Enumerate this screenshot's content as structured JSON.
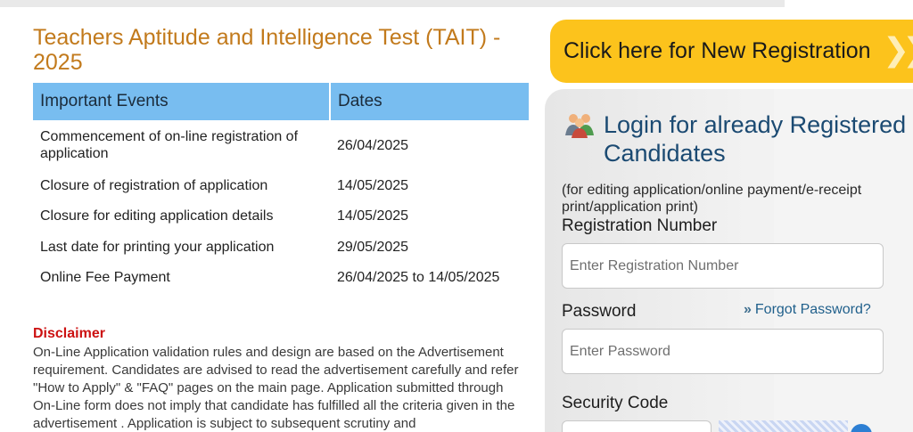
{
  "left": {
    "title": "Teachers Aptitude and Intelligence Test (TAIT) - 2025",
    "table": {
      "headers": [
        "Important Events",
        "Dates"
      ],
      "rows": [
        {
          "event": "Commencement of on-line registration of application",
          "date": "26/04/2025"
        },
        {
          "event": "Closure of registration of application",
          "date": "14/05/2025"
        },
        {
          "event": "Closure for editing application details",
          "date": "14/05/2025"
        },
        {
          "event": "Last date for printing your application",
          "date": "29/05/2025"
        },
        {
          "event": "Online Fee Payment",
          "date": "26/04/2025 to 14/05/2025"
        }
      ]
    },
    "disclaimer": {
      "title": "Disclaimer",
      "text": "On-Line Application validation rules and design are based on the Advertisement requirement. Candidates are advised to read the advertisement carefully and refer \"How to Apply\" & \"FAQ\" pages on the main page. Application submitted through On-Line form does not imply that candidate has fulfilled all the criteria given in the advertisement . Application is subject to subsequent scrutiny and"
    }
  },
  "right": {
    "new_registration_label": "Click here for New Registration",
    "login_title": "Login for already Registered Candidates",
    "login_note": "(for editing application/online payment/e-receipt print/application print)",
    "registration_label": "Registration Number",
    "registration_placeholder": "Enter Registration Number",
    "password_label": "Password",
    "password_placeholder": "Enter Password",
    "forgot_password": "Forgot Password?",
    "security_label": "Security Code"
  },
  "colors": {
    "title": "#c27a1c",
    "table_header": "#78bdf0",
    "registration_button": "#fcc31c",
    "disclaimer_title": "#cc1111",
    "login_title": "#1b4a72"
  },
  "icons": [
    "users-icon",
    "double-chevron-right-icon",
    "refresh-icon"
  ]
}
